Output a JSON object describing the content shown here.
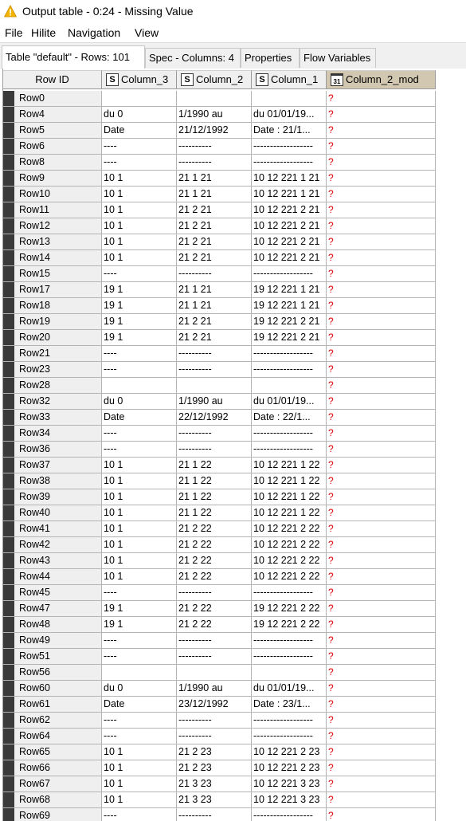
{
  "window": {
    "title": "Output table - 0:24 - Missing Value"
  },
  "menu": [
    "File",
    "Hilite",
    "Navigation",
    "View"
  ],
  "tabs": [
    "Table \"default\" - Rows: 101",
    "Spec - Columns: 4",
    "Properties",
    "Flow Variables"
  ],
  "columns": [
    {
      "label": "Row ID",
      "type": ""
    },
    {
      "label": "Column_3",
      "type": "S"
    },
    {
      "label": "Column_2",
      "type": "S"
    },
    {
      "label": "Column_1",
      "type": "S"
    },
    {
      "label": "Column_2_mod",
      "type": "31"
    }
  ],
  "rows": [
    [
      "Row0",
      "",
      "",
      "",
      "?"
    ],
    [
      "Row4",
      "du 0",
      "1/1990 au",
      "du 01/01/19...",
      "?"
    ],
    [
      "Row5",
      "Date",
      "21/12/1992",
      "Date : 21/1...",
      "?"
    ],
    [
      "Row6",
      "----",
      "----------",
      "------------------",
      "?"
    ],
    [
      "Row8",
      "----",
      "----------",
      "------------------",
      "?"
    ],
    [
      "Row9",
      "10 1",
      "21 1 21",
      "10 12 221 1 21",
      "?"
    ],
    [
      "Row10",
      "10 1",
      "21 1 21",
      "10 12 221 1 21",
      "?"
    ],
    [
      "Row11",
      "10 1",
      "21 2 21",
      "10 12 221 2 21",
      "?"
    ],
    [
      "Row12",
      "10 1",
      "21 2 21",
      "10 12 221 2 21",
      "?"
    ],
    [
      "Row13",
      "10 1",
      "21 2 21",
      "10 12 221 2 21",
      "?"
    ],
    [
      "Row14",
      "10 1",
      "21 2 21",
      "10 12 221 2 21",
      "?"
    ],
    [
      "Row15",
      "----",
      "----------",
      "------------------",
      "?"
    ],
    [
      "Row17",
      "19 1",
      "21 1 21",
      "19 12 221 1 21",
      "?"
    ],
    [
      "Row18",
      "19 1",
      "21 1 21",
      "19 12 221 1 21",
      "?"
    ],
    [
      "Row19",
      "19 1",
      "21 2 21",
      "19 12 221 2 21",
      "?"
    ],
    [
      "Row20",
      "19 1",
      "21 2 21",
      "19 12 221 2 21",
      "?"
    ],
    [
      "Row21",
      "----",
      "----------",
      "------------------",
      "?"
    ],
    [
      "Row23",
      "----",
      "----------",
      "------------------",
      "?"
    ],
    [
      "Row28",
      "",
      "",
      "",
      "?"
    ],
    [
      "Row32",
      "du 0",
      "1/1990 au",
      "du 01/01/19...",
      "?"
    ],
    [
      "Row33",
      "Date",
      "22/12/1992",
      "Date : 22/1...",
      "?"
    ],
    [
      "Row34",
      "----",
      "----------",
      "------------------",
      "?"
    ],
    [
      "Row36",
      "----",
      "----------",
      "------------------",
      "?"
    ],
    [
      "Row37",
      "10 1",
      "21 1 22",
      "10 12 221 1 22",
      "?"
    ],
    [
      "Row38",
      "10 1",
      "21 1 22",
      "10 12 221 1 22",
      "?"
    ],
    [
      "Row39",
      "10 1",
      "21 1 22",
      "10 12 221 1 22",
      "?"
    ],
    [
      "Row40",
      "10 1",
      "21 1 22",
      "10 12 221 1 22",
      "?"
    ],
    [
      "Row41",
      "10 1",
      "21 2 22",
      "10 12 221 2 22",
      "?"
    ],
    [
      "Row42",
      "10 1",
      "21 2 22",
      "10 12 221 2 22",
      "?"
    ],
    [
      "Row43",
      "10 1",
      "21 2 22",
      "10 12 221 2 22",
      "?"
    ],
    [
      "Row44",
      "10 1",
      "21 2 22",
      "10 12 221 2 22",
      "?"
    ],
    [
      "Row45",
      "----",
      "----------",
      "------------------",
      "?"
    ],
    [
      "Row47",
      "19 1",
      "21 2 22",
      "19 12 221 2 22",
      "?"
    ],
    [
      "Row48",
      "19 1",
      "21 2 22",
      "19 12 221 2 22",
      "?"
    ],
    [
      "Row49",
      "----",
      "----------",
      "------------------",
      "?"
    ],
    [
      "Row51",
      "----",
      "----------",
      "------------------",
      "?"
    ],
    [
      "Row56",
      "",
      "",
      "",
      "?"
    ],
    [
      "Row60",
      "du 0",
      "1/1990 au",
      "du 01/01/19...",
      "?"
    ],
    [
      "Row61",
      "Date",
      "23/12/1992",
      "Date : 23/1...",
      "?"
    ],
    [
      "Row62",
      "----",
      "----------",
      "------------------",
      "?"
    ],
    [
      "Row64",
      "----",
      "----------",
      "------------------",
      "?"
    ],
    [
      "Row65",
      "10 1",
      "21 2 23",
      "10 12 221 2 23",
      "?"
    ],
    [
      "Row66",
      "10 1",
      "21 2 23",
      "10 12 221 2 23",
      "?"
    ],
    [
      "Row67",
      "10 1",
      "21 3 23",
      "10 12 221 3 23",
      "?"
    ],
    [
      "Row68",
      "10 1",
      "21 3 23",
      "10 12 221 3 23",
      "?"
    ],
    [
      "Row69",
      "----",
      "----------",
      "------------------",
      "?"
    ]
  ],
  "colors": {
    "warning": "#f4b400",
    "missing": "#e00000",
    "selected_header": "#d2c7b0"
  },
  "icons": {
    "title": "warning-triangle-icon",
    "string_type": "string-type-icon",
    "date_type": "calendar-icon"
  }
}
